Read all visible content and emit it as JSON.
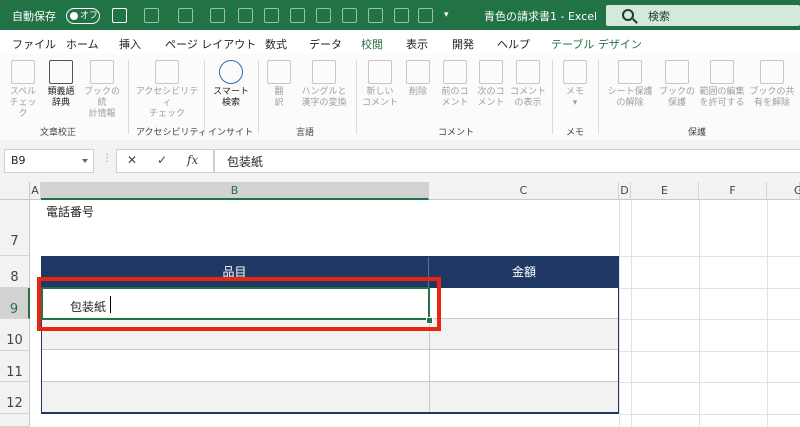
{
  "titlebar": {
    "autosave_label": "自動保存",
    "autosave_state": "オフ",
    "doc_title": "青色の請求書1 - Excel",
    "search_placeholder": "検索",
    "bg_color": "#217346"
  },
  "tabs": [
    "ファイル",
    "ホーム",
    "挿入",
    "ページ レイアウト",
    "数式",
    "データ",
    "校閲",
    "表示",
    "開発",
    "ヘルプ",
    "テーブル デザイン"
  ],
  "active_tab": "校閲",
  "ribbon": {
    "proofing": {
      "group": "文章校正",
      "spelling": [
        "スペル",
        "チェック"
      ],
      "thesaurus": [
        "類義語",
        "辞典"
      ],
      "stats": [
        "ブックの統",
        "計情報"
      ]
    },
    "accessibility": {
      "group": "アクセシビリティ",
      "check": [
        "アクセシビリティ",
        "チェック"
      ]
    },
    "insights": {
      "group": "インサイト",
      "smart_lookup": [
        "スマート",
        "検索"
      ]
    },
    "language": {
      "group": "言語",
      "translate": [
        "翻",
        "訳"
      ],
      "hangul": [
        "ハングルと",
        "漢字の変換"
      ]
    },
    "comments": {
      "group": "コメント",
      "new": [
        "新しい",
        "コメント"
      ],
      "delete": [
        "削除"
      ],
      "prev": [
        "前のコ",
        "メント"
      ],
      "next": [
        "次のコ",
        "メント"
      ],
      "show": [
        "コメント",
        "の表示"
      ]
    },
    "memo": {
      "group": "メモ",
      "memo": [
        "メモ"
      ]
    },
    "protect": {
      "group": "保護",
      "unprotect_sheet": [
        "シート保護",
        "の解除"
      ],
      "protect_book": [
        "ブックの",
        "保護"
      ],
      "allow_edit": [
        "範囲の編集",
        "を許可する"
      ],
      "unshare": [
        "ブックの共",
        "有を解除"
      ]
    }
  },
  "formula_bar": {
    "name_box": "B9",
    "cancel_symbol": "✕",
    "enter_symbol": "✓",
    "fx": "fx",
    "content": "包装紙"
  },
  "sheet": {
    "columns": [
      "A",
      "B",
      "C",
      "D",
      "E",
      "F",
      "G"
    ],
    "rows": [
      "7",
      "8",
      "9",
      "10",
      "11",
      "12"
    ],
    "above_text": "電話番号",
    "header_item": "品目",
    "header_amount": "金額",
    "editing_cell_text": "包装紙",
    "header_color": "#1f3864",
    "highlight_color": "#e8250f"
  }
}
